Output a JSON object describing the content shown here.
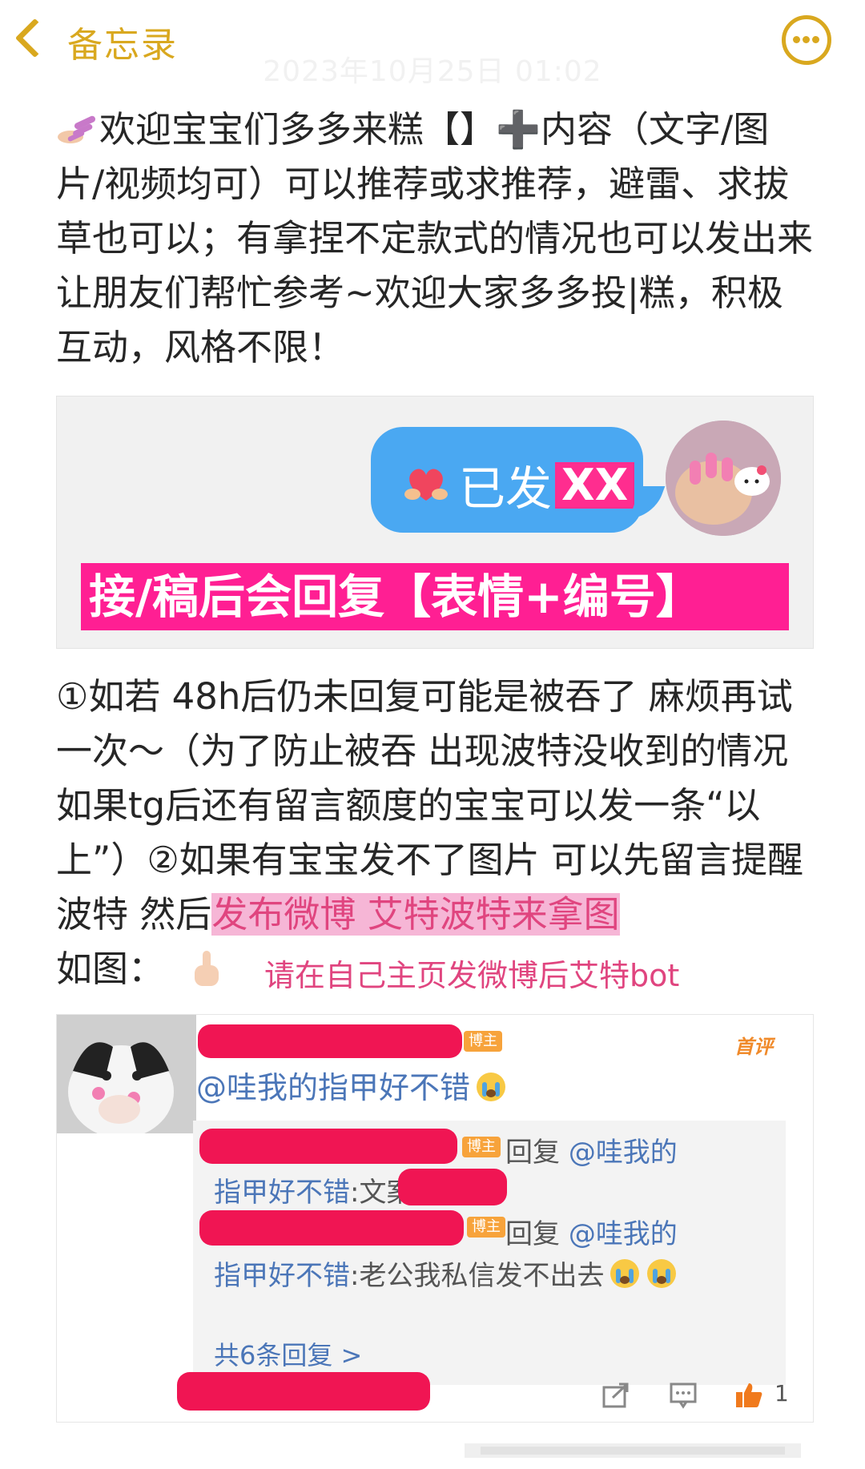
{
  "topbar": {
    "back_label": "备忘录",
    "date_watermark": "2023年10月25日 01:02"
  },
  "intro": {
    "text_1": "欢迎宝宝们多多来糕【】",
    "plus": "➕",
    "text_2": "内容（文字/图片/视频均可）可以推荐或求推荐，避雷、求拔草也可以；有拿捏不定款式的情况也可以发出来让朋友们帮忙参考~欢迎大家多多投|糕，积极互动，风格不限！"
  },
  "image1": {
    "bubble_text": "已发",
    "bubble_highlight": "XX",
    "banner_text": "接/稿后会回复【表情+编号】"
  },
  "notes": {
    "text_1": "①如若 48h后仍未回复可能是被吞了 麻烦再试一次～（为了防止被吞 出现波特没收到的情况 如果tg后还有留言额度的宝宝可以发一条“以上”）②如果有宝宝发不了图片 可以先留言提醒波特 然后",
    "highlight": "发布微博 艾特波特来拿图",
    "text_2": "如图：",
    "pink_note": "请在自己主页发微博后艾特bot"
  },
  "image2": {
    "badge": "博主",
    "first_tag": "首评",
    "comment": "@哇我的指甲好不错",
    "replies": [
      {
        "prefix": "回复 ",
        "mention": "@哇我的",
        "line2_mention": "指甲好不错",
        "line2_text": ":文案"
      },
      {
        "prefix": "回复 ",
        "mention": "@哇我的",
        "line2_mention": "指甲好不错",
        "line2_text": ":老公我私信发不出去"
      }
    ],
    "more_replies": "共6条回复 >",
    "like_count": "1"
  },
  "colors": {
    "accent": "#d9a81f",
    "link": "#4b76b8",
    "pink": "#ff1f93",
    "highlight_pink": "#f6b6d6",
    "redaction": "#f01553"
  },
  "icons": [
    "back-chevron-icon",
    "more-icon",
    "nail-polish-icon",
    "heart-hands-icon",
    "pointing-down-icon",
    "crying-face-icon",
    "share-icon",
    "comment-icon",
    "like-icon"
  ]
}
